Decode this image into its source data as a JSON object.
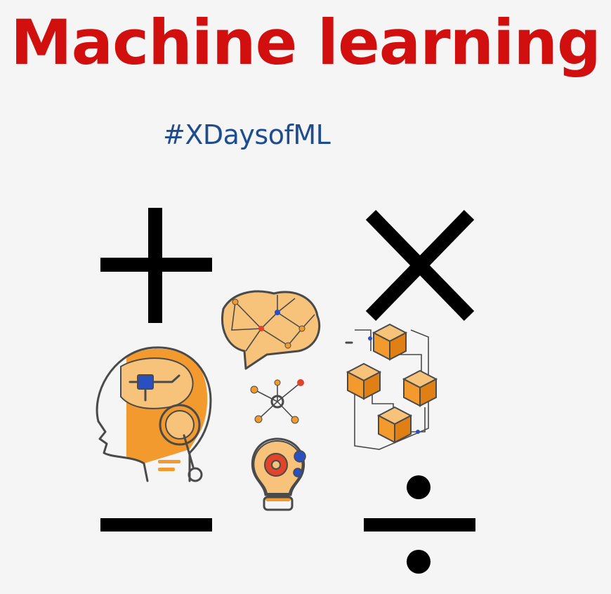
{
  "header": {
    "title": "Machine learning",
    "hashtag": "#XDaysofML"
  },
  "colors": {
    "title": "#d20f0f",
    "hashtag": "#1f4b8f",
    "symbol": "#000000",
    "accent_orange": "#f29a2e",
    "light_orange": "#f7c27a",
    "outline": "#4a4a4a",
    "chip_blue": "#2a4fbf",
    "node_red": "#e0442a"
  },
  "illustration": {
    "symbols": [
      "plus-sign",
      "multiply-sign",
      "minus-sign",
      "divide-sign"
    ],
    "icons": [
      "robot-head-icon",
      "brain-network-icon",
      "network-node-icon",
      "lightbulb-gears-icon",
      "blockchain-cubes-icon"
    ]
  }
}
